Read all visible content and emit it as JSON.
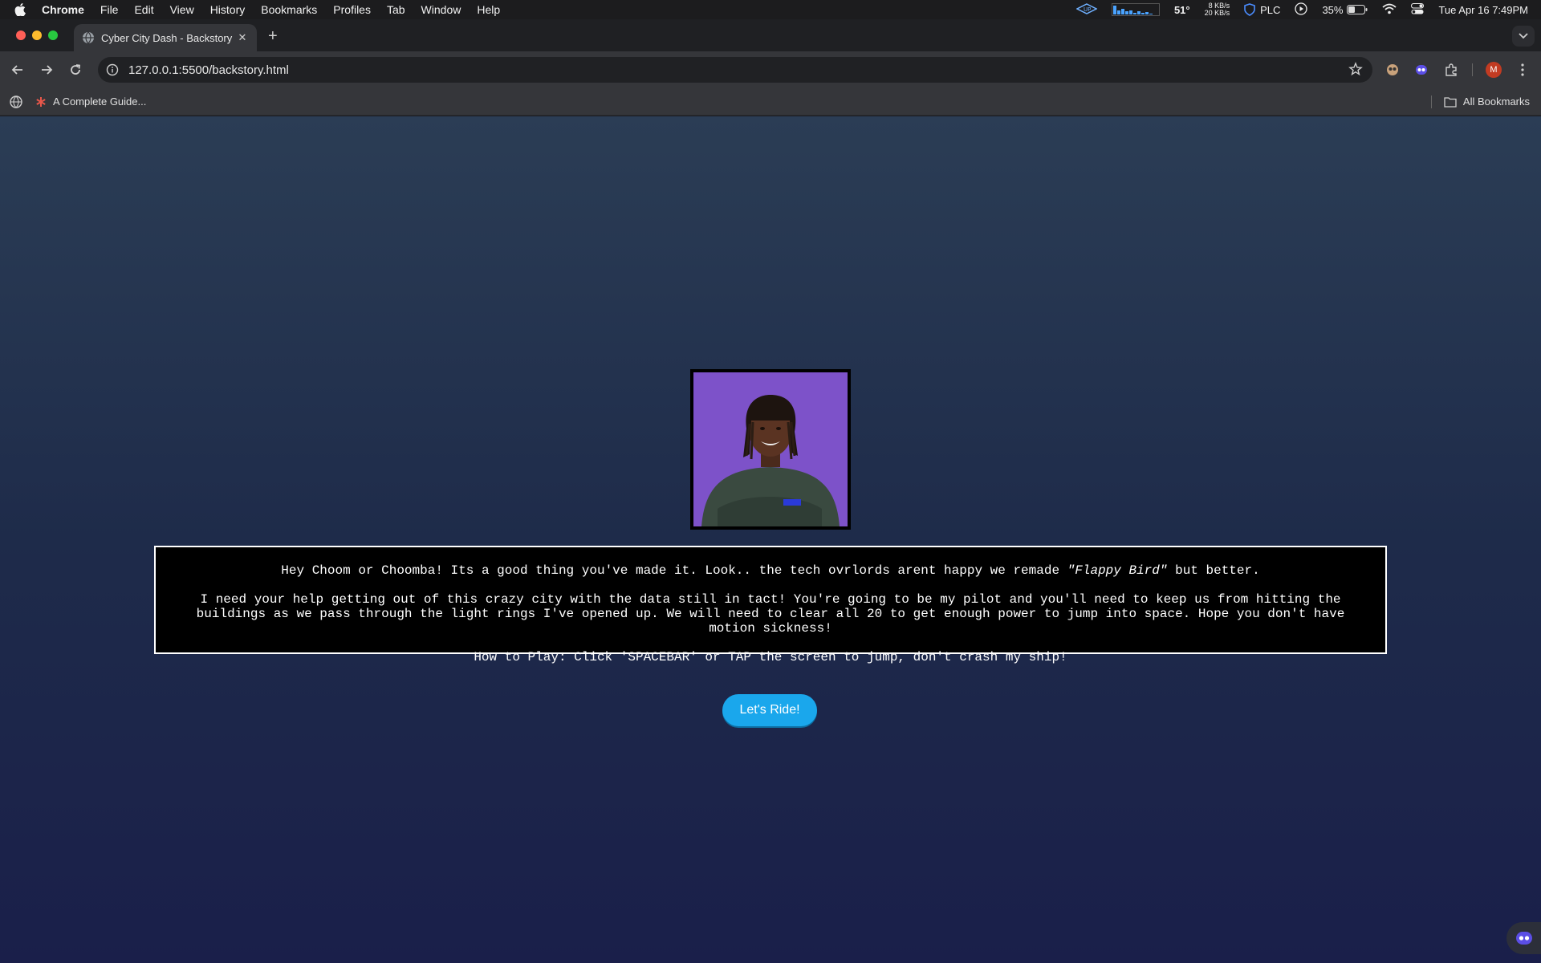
{
  "menubar": {
    "app": "Chrome",
    "items": [
      "File",
      "Edit",
      "View",
      "History",
      "Bookmarks",
      "Profiles",
      "Tab",
      "Window",
      "Help"
    ],
    "temperature": "51°",
    "net_up": "8 KB/s",
    "net_down": "20 KB/s",
    "vpn_label": "PLC",
    "battery": "35%",
    "datetime": "Tue Apr 16  7:49PM"
  },
  "tab": {
    "title": "Cyber City Dash - Backstory",
    "close_glyph": "✕",
    "new_tab_glyph": "+"
  },
  "toolbar": {
    "url": "127.0.0.1:5500/backstory.html",
    "profile_initial": "M"
  },
  "bookmarks": {
    "item": "A Complete Guide...",
    "all": "All Bookmarks"
  },
  "story": {
    "line1_pre": "Hey Choom or Choomba! Its a good thing you've made it. Look.. the tech ovrlords arent happy we remade ",
    "line1_em": "\"Flappy Bird\"",
    "line1_post": " but better.",
    "line2": "I need your help getting out of this crazy city with the data still in tact! You're going to be my pilot and you'll need to keep us from hitting the buildings as we pass through the light rings I've opened up. We will need to clear all 20 to get enough power to jump into space. Hope you don't have motion sickness!",
    "line3": "How to Play: Click 'SPACEBAR' or TAP the screen to jump, don't crash my ship!"
  },
  "button": {
    "label": "Let's Ride!"
  },
  "icons": {
    "back": "arrow-left-icon",
    "forward": "arrow-right-icon",
    "reload": "reload-icon",
    "info": "info-icon",
    "star": "star-icon"
  },
  "colors": {
    "accent_button": "#1aa7ec",
    "page_top": "#2b3d55",
    "page_bottom": "#1a1f4a",
    "portrait_bg": "#7d52c9"
  }
}
